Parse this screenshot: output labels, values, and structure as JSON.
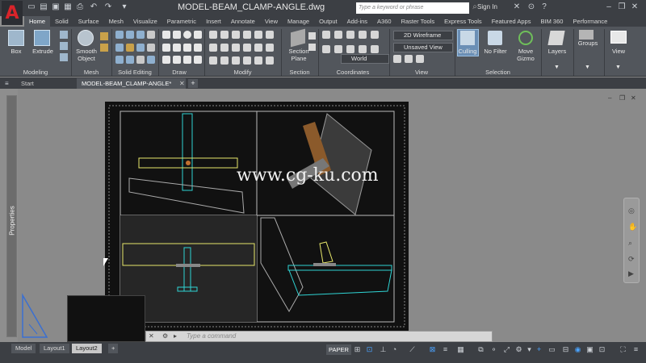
{
  "app": {
    "logo_letter": "A",
    "document_title": "MODEL-BEAM_CLAMP-ANGLE.dwg"
  },
  "search": {
    "placeholder": "Type a keyword or phrase"
  },
  "account": {
    "signin_label": "Sign In"
  },
  "ribbon_tabs": [
    "Home",
    "Solid",
    "Surface",
    "Mesh",
    "Visualize",
    "Parametric",
    "Insert",
    "Annotate",
    "View",
    "Manage",
    "Output",
    "Add-ins",
    "A360",
    "Raster Tools",
    "Express Tools",
    "Featured Apps",
    "BIM 360",
    "Performance"
  ],
  "ribbon": {
    "box": "Box",
    "extrude": "Extrude",
    "smooth_object": "Smooth Object",
    "section_plane": "Section Plane",
    "culling": "Culling",
    "no_filter": "No Filter",
    "move_gizmo": "Move Gizmo",
    "layers": "Layers",
    "groups": "Groups",
    "view": "View",
    "visual_style": "2D Wireframe",
    "saved_view": "Unsaved View",
    "ucs": "World"
  },
  "panels": [
    "Modeling",
    "Mesh",
    "Solid Editing",
    "Draw",
    "Modify",
    "Section",
    "Coordinates",
    "View",
    "Selection"
  ],
  "file_tabs": {
    "start": "Start",
    "active": "MODEL-BEAM_CLAMP-ANGLE*",
    "add": "+"
  },
  "side_panel": {
    "properties": "Properties"
  },
  "watermark": "www.cg-ku.com",
  "command_line": {
    "placeholder": "Type a command"
  },
  "layout_tabs": [
    "Model",
    "Layout1",
    "Layout2"
  ],
  "active_layout": "Layout2",
  "status": {
    "paper_label": "PAPER"
  },
  "colors": {
    "accent_red": "#d9242a",
    "cyan": "#2fd4d4",
    "yellow": "#e6e66a",
    "brown": "#8b5a2b"
  }
}
